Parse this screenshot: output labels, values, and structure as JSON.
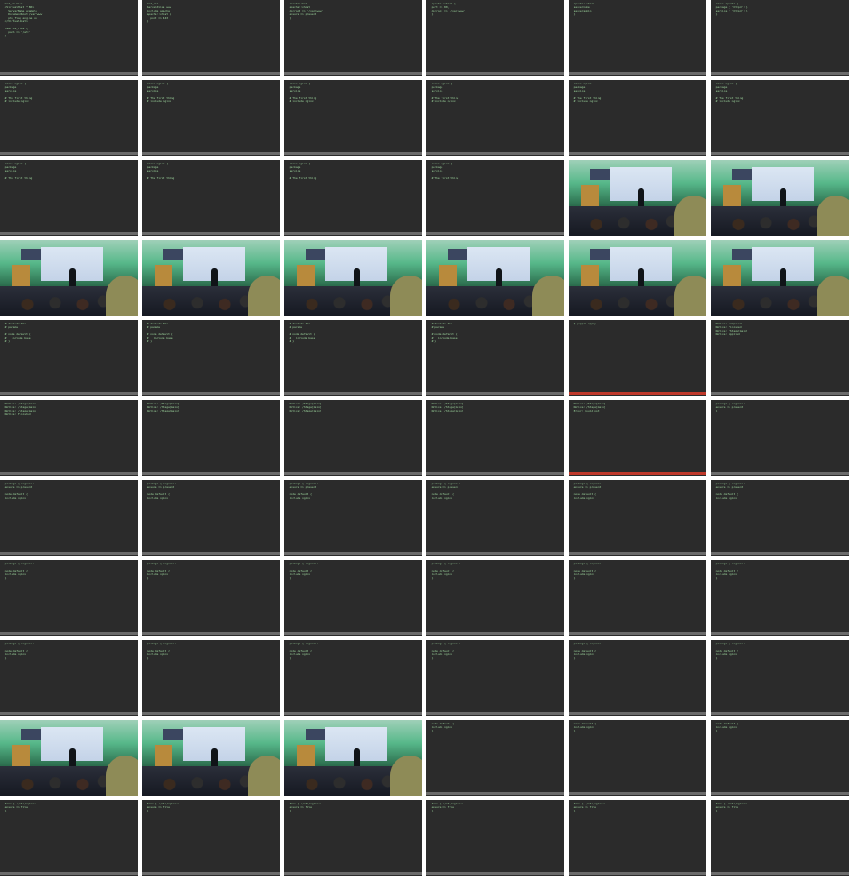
{
  "title": "Video contact sheet",
  "grid": {
    "columns": 6,
    "rows": 11
  },
  "colors": {
    "terminal_bg": "#2b2b2b",
    "terminal_text": "#9fd89f",
    "status_bar": "#6b6b6b",
    "status_alert": "#c0392b"
  },
  "tiles": [
    {
      "kind": "terminal",
      "status": "normal",
      "lines": [
        "  mod_rewrite",
        "  <VirtualHost *:80>",
        "    ServerName example",
        "    DocumentRoot /var/www",
        "    php_flag engine on",
        "  </VirtualHost>",
        "",
        "  rewrite_rule {",
        "    path => '/etc'",
        "  }"
      ]
    },
    {
      "kind": "terminal",
      "status": "normal",
      "lines": [
        "  mod_ssl",
        "  ServerAlias www",
        "  include apache",
        "  apache::vhost {",
        "    port => 443",
        "  }"
      ]
    },
    {
      "kind": "terminal",
      "status": "normal",
      "lines": [
        "  apache::mod",
        "  apache::vhost",
        "  docroot => '/var/www'",
        "  ensure => present",
        "  }"
      ]
    },
    {
      "kind": "terminal",
      "status": "normal",
      "lines": [
        "  apache::vhost {",
        "  port => 80,",
        "  docroot => '/var/www',",
        "  }"
      ]
    },
    {
      "kind": "terminal",
      "status": "normal",
      "lines": [
        "  apache::vhost",
        "  servername",
        "  serveradmin",
        "  }"
      ]
    },
    {
      "kind": "terminal",
      "status": "normal",
      "lines": [
        "  class apache {",
        "  package { 'httpd': }",
        "  service { 'httpd': }",
        "  }"
      ]
    },
    {
      "kind": "terminal",
      "status": "normal",
      "lines": [
        "  class nginx {",
        "  package",
        "  service",
        "",
        "  # The first thing",
        "  # include nginx"
      ]
    },
    {
      "kind": "terminal",
      "status": "normal",
      "lines": [
        "  class nginx {",
        "  package",
        "  service",
        "",
        "  # The first thing",
        "  # include nginx"
      ]
    },
    {
      "kind": "terminal",
      "status": "normal",
      "lines": [
        "  class nginx {",
        "  package",
        "  service",
        "",
        "  # The first thing",
        "  # include nginx"
      ]
    },
    {
      "kind": "terminal",
      "status": "normal",
      "lines": [
        "  class nginx {",
        "  package",
        "  service",
        "",
        "  # The first thing",
        "  # include nginx"
      ]
    },
    {
      "kind": "terminal",
      "status": "normal",
      "lines": [
        "  class nginx {",
        "  package",
        "  service",
        "",
        "  # The first thing",
        "  # include nginx"
      ]
    },
    {
      "kind": "terminal",
      "status": "normal",
      "lines": [
        "  class nginx {",
        "  package",
        "  service",
        "",
        "  # The first thing",
        "  # include nginx"
      ]
    },
    {
      "kind": "terminal",
      "status": "normal",
      "lines": [
        "  class nginx {",
        "  package",
        "  service",
        "",
        "  # The first thing"
      ]
    },
    {
      "kind": "terminal",
      "status": "normal",
      "lines": [
        "  class nginx {",
        "  package",
        "  service",
        "",
        "  # The first thing"
      ]
    },
    {
      "kind": "terminal",
      "status": "normal",
      "lines": [
        "  class nginx {",
        "  package",
        "  service",
        "",
        "  # The first thing"
      ]
    },
    {
      "kind": "terminal",
      "status": "normal",
      "lines": [
        "  class nginx {",
        "  package",
        "  service",
        "",
        "  # The first thing"
      ]
    },
    {
      "kind": "photo"
    },
    {
      "kind": "photo"
    },
    {
      "kind": "photo"
    },
    {
      "kind": "photo"
    },
    {
      "kind": "photo"
    },
    {
      "kind": "photo"
    },
    {
      "kind": "photo"
    },
    {
      "kind": "photo"
    },
    {
      "kind": "terminal",
      "status": "normal",
      "lines": [
        "  # Include the",
        "  # params",
        "",
        "  # node default {",
        "  #   include base",
        "  # }"
      ]
    },
    {
      "kind": "terminal",
      "status": "normal",
      "lines": [
        "  # Include the",
        "  # params",
        "",
        "  # node default {",
        "  #   include base",
        "  # }"
      ]
    },
    {
      "kind": "terminal",
      "status": "normal",
      "lines": [
        "  # Include the",
        "  # params",
        "",
        "  # node default {",
        "  #   include base",
        "  # }"
      ]
    },
    {
      "kind": "terminal",
      "status": "normal",
      "lines": [
        "  # Include the",
        "  # params",
        "",
        "  # node default {",
        "  #   include base",
        "  # }"
      ]
    },
    {
      "kind": "terminal",
      "status": "alert",
      "lines": [
        "  $ puppet apply",
        "",
        "",
        ""
      ]
    },
    {
      "kind": "terminal",
      "status": "normal",
      "lines": [
        "  Notice: Compiled",
        "  Notice: Finished",
        "  Notice: /Stage[main]",
        "  Notice: Applied"
      ]
    },
    {
      "kind": "terminal",
      "status": "normal",
      "lines": [
        "  Notice: /Stage[main]",
        "  Notice: /Stage[main]",
        "  Notice: /Stage[main]",
        "  Notice: Finished"
      ]
    },
    {
      "kind": "terminal",
      "status": "normal",
      "lines": [
        "  Notice: /Stage[main]",
        "  Notice: /Stage[main]",
        "  Notice: /Stage[main]"
      ]
    },
    {
      "kind": "terminal",
      "status": "normal",
      "lines": [
        "  Notice: /Stage[main]",
        "  Notice: /Stage[main]",
        "  Notice: /Stage[main]"
      ]
    },
    {
      "kind": "terminal",
      "status": "normal",
      "lines": [
        "  Notice: /Stage[main]",
        "  Notice: /Stage[main]",
        "  Notice: /Stage[main]"
      ]
    },
    {
      "kind": "terminal",
      "status": "alert",
      "lines": [
        "  Notice: /Stage[main]",
        "  Notice: /Stage[main]",
        "  Error: Could not"
      ]
    },
    {
      "kind": "terminal",
      "status": "normal",
      "lines": [
        "  package { 'nginx':",
        "  ensure => present",
        "  }"
      ]
    },
    {
      "kind": "terminal",
      "status": "normal",
      "lines": [
        "  package { 'nginx':",
        "  ensure => present",
        "",
        "  node default {",
        "  include nginx"
      ]
    },
    {
      "kind": "terminal",
      "status": "normal",
      "lines": [
        "  package { 'nginx':",
        "  ensure => present",
        "",
        "  node default {",
        "  include nginx"
      ]
    },
    {
      "kind": "terminal",
      "status": "normal",
      "lines": [
        "  package { 'nginx':",
        "  ensure => present",
        "",
        "  node default {",
        "  include nginx"
      ]
    },
    {
      "kind": "terminal",
      "status": "normal",
      "lines": [
        "  package { 'nginx':",
        "  ensure => present",
        "",
        "  node default {",
        "  include nginx"
      ]
    },
    {
      "kind": "terminal",
      "status": "normal",
      "lines": [
        "  package { 'nginx':",
        "  ensure => present",
        "",
        "  node default {",
        "  include nginx"
      ]
    },
    {
      "kind": "terminal",
      "status": "normal",
      "lines": [
        "  package { 'nginx':",
        "  ensure => present",
        "",
        "  node default {",
        "  include nginx"
      ]
    },
    {
      "kind": "terminal",
      "status": "normal",
      "lines": [
        "  package { 'nginx':",
        "",
        "  node default {",
        "  include nginx",
        "  }"
      ]
    },
    {
      "kind": "terminal",
      "status": "normal",
      "lines": [
        "  package { 'nginx':",
        "",
        "  node default {",
        "  include nginx",
        "  }"
      ]
    },
    {
      "kind": "terminal",
      "status": "normal",
      "lines": [
        "  package { 'nginx':",
        "",
        "  node default {",
        "  include nginx",
        "  }"
      ]
    },
    {
      "kind": "terminal",
      "status": "normal",
      "lines": [
        "  package { 'nginx':",
        "",
        "  node default {",
        "  include nginx",
        "  }"
      ]
    },
    {
      "kind": "terminal",
      "status": "normal",
      "lines": [
        "  package { 'nginx':",
        "",
        "  node default {",
        "  include nginx",
        "  }"
      ]
    },
    {
      "kind": "terminal",
      "status": "normal",
      "lines": [
        "  package { 'nginx':",
        "",
        "  node default {",
        "  include nginx",
        "  }"
      ]
    },
    {
      "kind": "terminal",
      "status": "normal",
      "lines": [
        "  package { 'nginx':",
        "",
        "  node default {",
        "  include nginx",
        "  }"
      ]
    },
    {
      "kind": "terminal",
      "status": "normal",
      "lines": [
        "  package { 'nginx':",
        "",
        "  node default {",
        "  include nginx",
        "  }"
      ]
    },
    {
      "kind": "terminal",
      "status": "normal",
      "lines": [
        "  package { 'nginx':",
        "",
        "  node default {",
        "  include nginx",
        "  }"
      ]
    },
    {
      "kind": "terminal",
      "status": "normal",
      "lines": [
        "  package { 'nginx':",
        "",
        "  node default {",
        "  include nginx",
        "  }"
      ]
    },
    {
      "kind": "terminal",
      "status": "normal",
      "lines": [
        "  package { 'nginx':",
        "",
        "  node default {",
        "  include nginx",
        "  }"
      ]
    },
    {
      "kind": "terminal",
      "status": "normal",
      "lines": [
        "  package { 'nginx':",
        "",
        "  node default {",
        "  include nginx",
        "  }"
      ]
    },
    {
      "kind": "photo"
    },
    {
      "kind": "photo"
    },
    {
      "kind": "photo"
    },
    {
      "kind": "terminal",
      "status": "normal",
      "lines": [
        "  node default {",
        "  include nginx",
        "  }"
      ]
    },
    {
      "kind": "terminal",
      "status": "normal",
      "lines": [
        "  node default {",
        "  include nginx",
        "  }"
      ]
    },
    {
      "kind": "terminal",
      "status": "normal",
      "lines": [
        "  node default {",
        "  include nginx",
        "  }"
      ]
    },
    {
      "kind": "terminal",
      "status": "normal",
      "lines": [
        "  file { '/etc/nginx':",
        "  ensure => file",
        "  }"
      ]
    },
    {
      "kind": "terminal",
      "status": "normal",
      "lines": [
        "  file { '/etc/nginx':",
        "  ensure => file",
        "  }"
      ]
    },
    {
      "kind": "terminal",
      "status": "normal",
      "lines": [
        "  file { '/etc/nginx':",
        "  ensure => file",
        "  }"
      ]
    },
    {
      "kind": "terminal",
      "status": "normal",
      "lines": [
        "  file { '/etc/nginx':",
        "  ensure => file",
        "  }"
      ]
    },
    {
      "kind": "terminal",
      "status": "normal",
      "lines": [
        "  file { '/etc/nginx':",
        "  ensure => file",
        "  }"
      ]
    },
    {
      "kind": "terminal",
      "status": "normal",
      "lines": [
        "  file { '/etc/nginx':",
        "  ensure => file",
        "  }"
      ]
    }
  ]
}
